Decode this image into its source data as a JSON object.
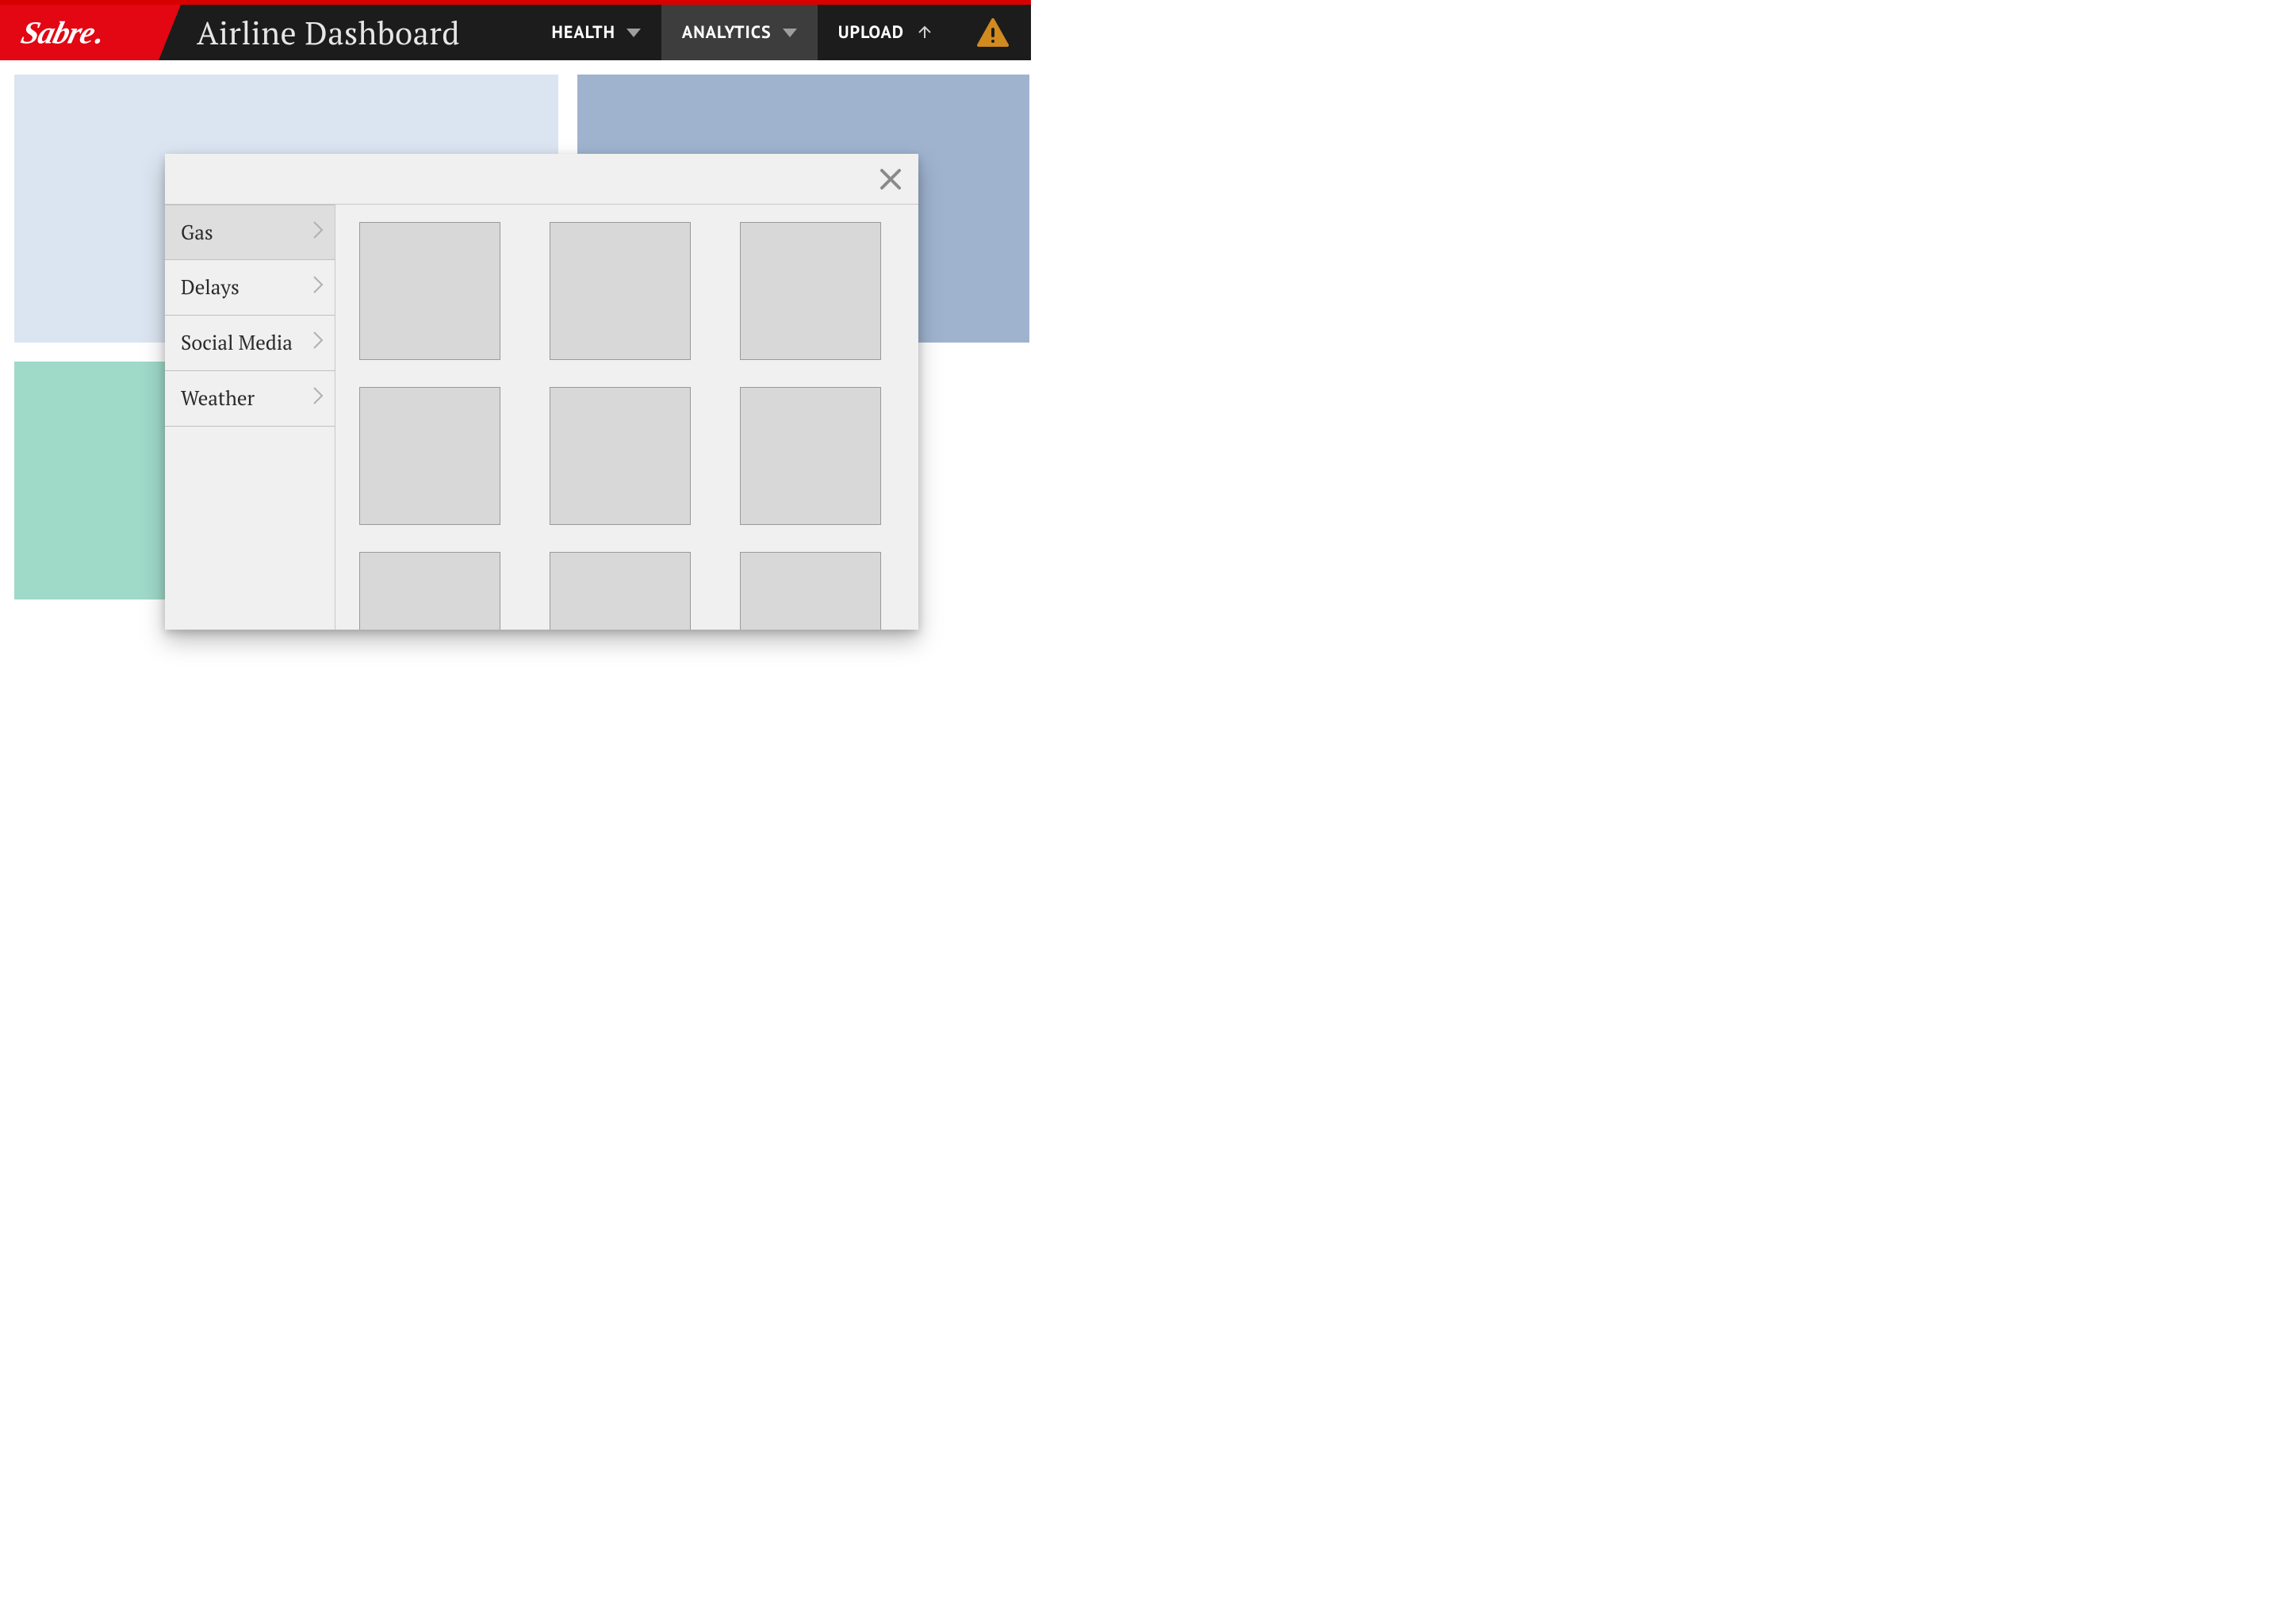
{
  "brand": {
    "name": "Sabre"
  },
  "header": {
    "title": "Airline Dashboard",
    "nav": [
      {
        "label": "HEALTH",
        "active": false,
        "kind": "dropdown"
      },
      {
        "label": "ANALYTICS",
        "active": true,
        "kind": "dropdown"
      },
      {
        "label": "UPLOAD",
        "active": false,
        "kind": "upload"
      }
    ],
    "alert": true
  },
  "dashboard": {
    "cards": [
      {
        "id": "card-top-left",
        "color": "#dbe5f1"
      },
      {
        "id": "card-top-right",
        "color": "#9fb3cf"
      },
      {
        "id": "card-bottom-left",
        "color": "#9fd9c8"
      }
    ]
  },
  "modal": {
    "open": true,
    "categories": [
      {
        "label": "Gas",
        "selected": true
      },
      {
        "label": "Delays",
        "selected": false
      },
      {
        "label": "Social Media",
        "selected": false
      },
      {
        "label": "Weather",
        "selected": false
      }
    ],
    "thumbnails": {
      "count": 9
    }
  }
}
